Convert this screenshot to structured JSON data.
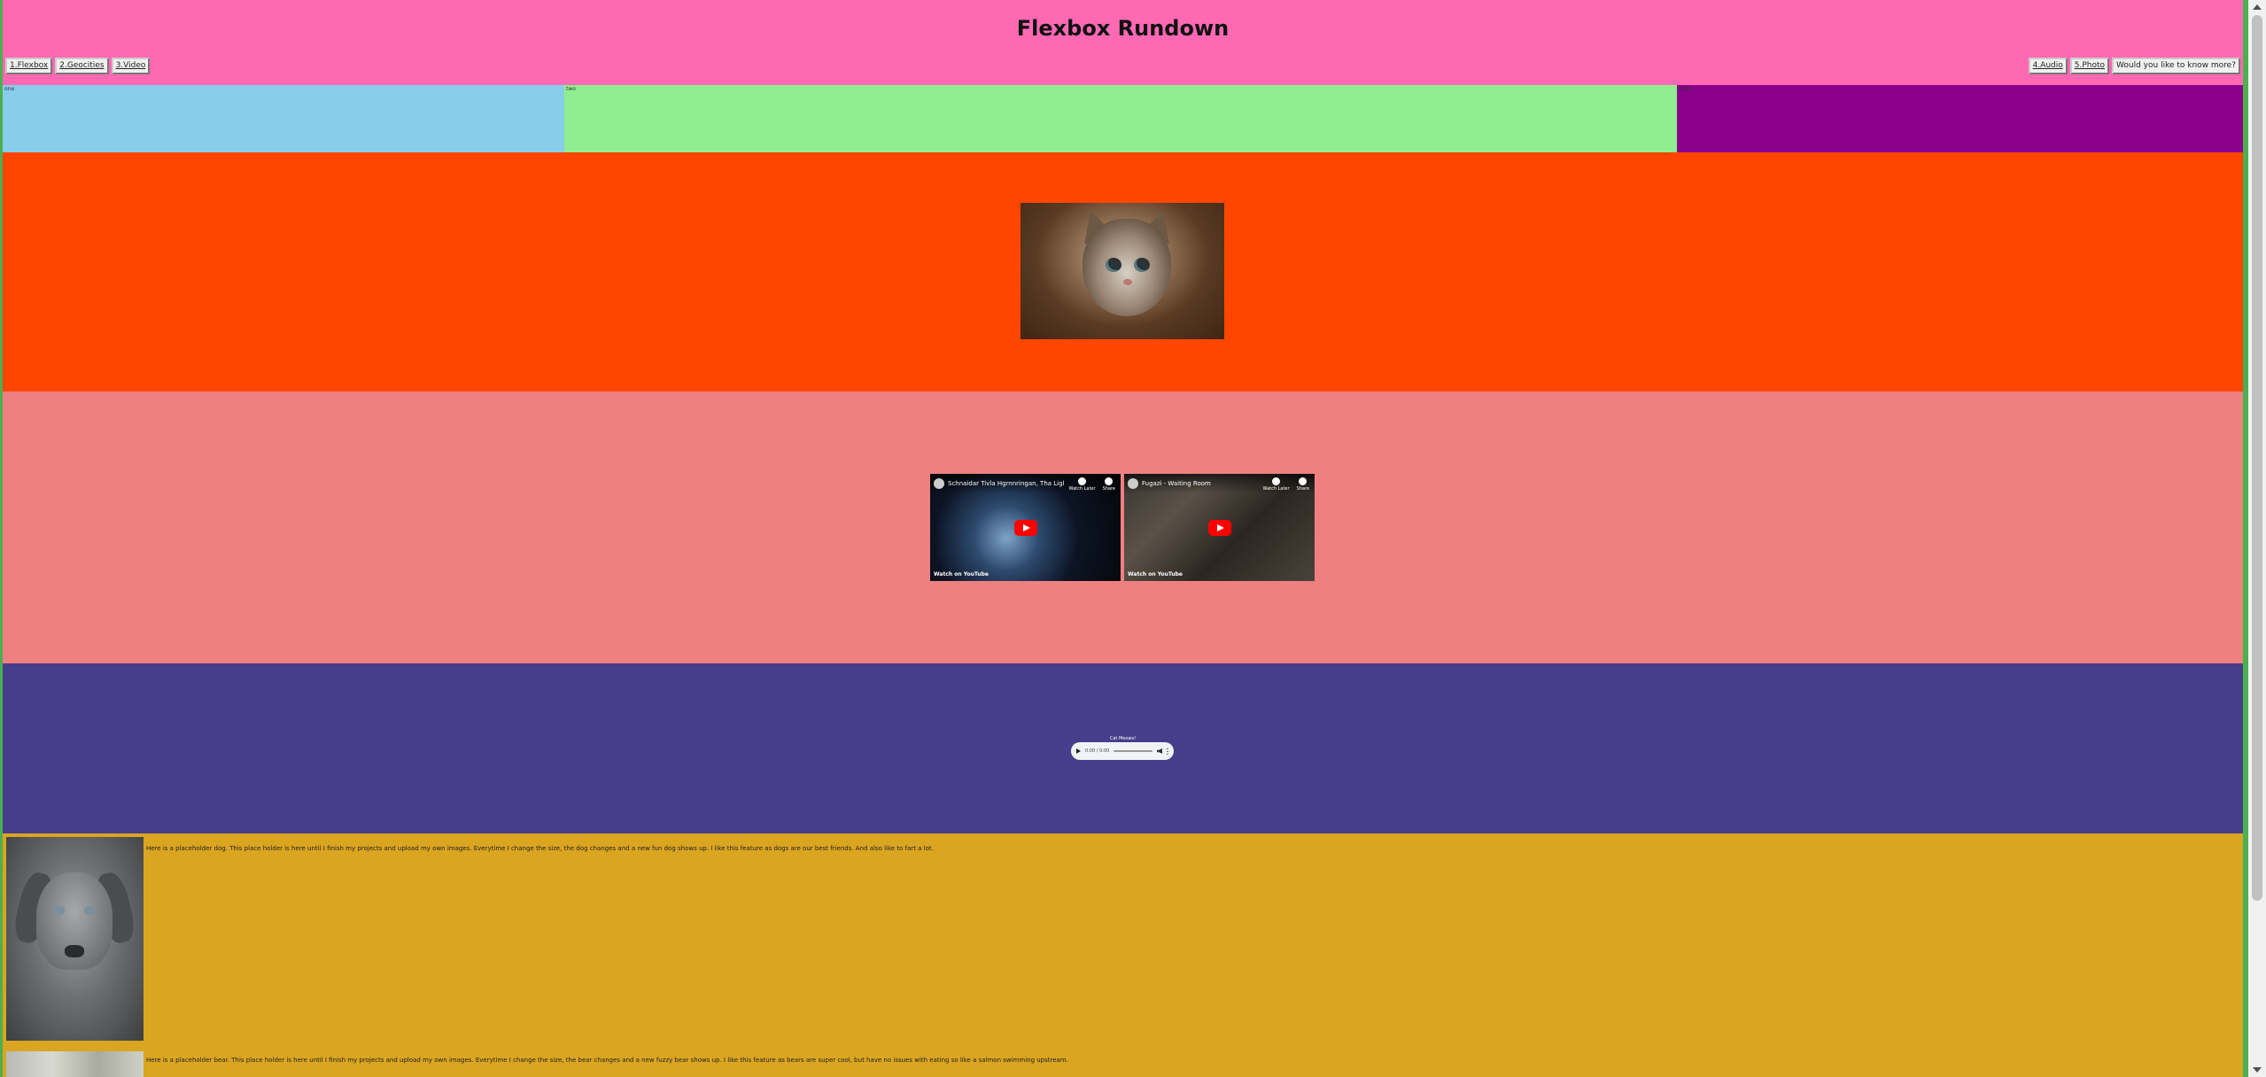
{
  "header": {
    "title": "Flexbox Rundown",
    "nav_left": [
      "1.Flexbox",
      "2.Geocities",
      "3.Video"
    ],
    "nav_right": [
      "4.Audio",
      "5.Photo"
    ],
    "more_button": "Would you like to know more?"
  },
  "color_boxes": [
    "one",
    "two",
    "three"
  ],
  "colors": {
    "header_bg": "#ff69b4",
    "box_one": "#87ceeb",
    "box_two": "#90ee90",
    "box_three": "#8b008b",
    "image_section": "#ff4500",
    "video_section": "#f08080",
    "audio_section": "#483d8b",
    "article_section": "#daa520"
  },
  "videos": [
    {
      "title": "Schnaidar Tivla Hgrnnringan, Tha Ligl",
      "watch_on": "Watch on YouTube",
      "actions": [
        "Watch Later",
        "Share"
      ]
    },
    {
      "title": "Fugazi - Waiting Room",
      "watch_on": "Watch on YouTube",
      "actions": [
        "Watch Later",
        "Share"
      ]
    }
  ],
  "audio": {
    "caption": "Cat Meows!",
    "time": "0:00 / 0:00"
  },
  "articles": [
    {
      "text": "Here is a placeholder dog. This place holder is here until I finish my projects and upload my own images. Everytime I change the size, the dog changes and a new fun dog shows up. I like this feature as dogs are our best friends. And also like to fart a lot."
    },
    {
      "text": "Here is a placeholder bear. This place holder is here until I finish my projects and upload my own images. Everytime I change the size, the bear changes and a new fuzzy bear shows up. I like this feature as bears are super cool, but have no issues with eating so like a salmon swimming upstream."
    }
  ]
}
